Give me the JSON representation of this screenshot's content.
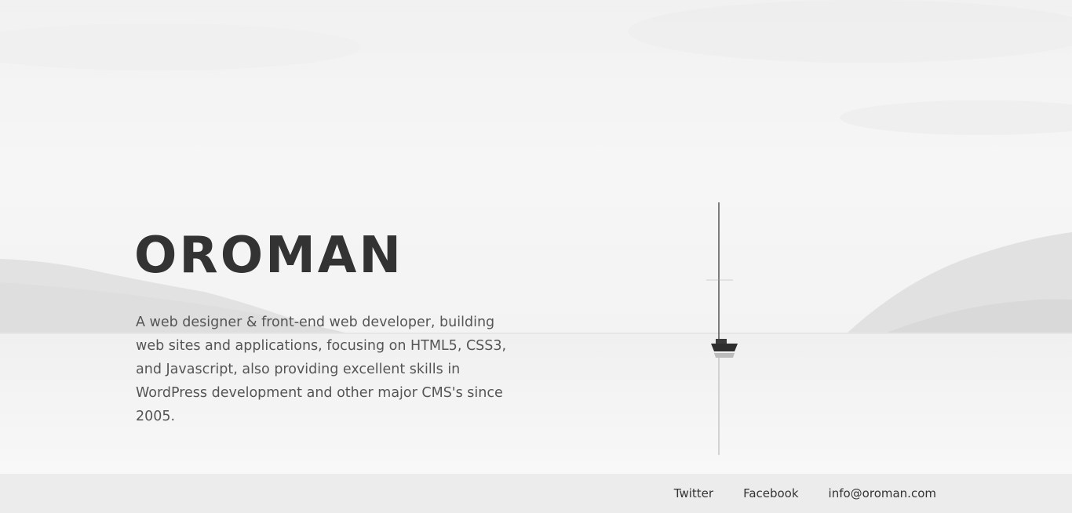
{
  "site": {
    "logo": "OROMAN",
    "tagline": "A web designer & front-end web developer, building web sites and applications, focusing on HTML5, CSS3, and Javascript, also providing excellent skills in WordPress development and other major CMS's since 2005."
  },
  "footer": {
    "links": [
      {
        "label": "Twitter"
      },
      {
        "label": "Facebook"
      },
      {
        "label": "info@oroman.com"
      }
    ]
  },
  "colors": {
    "text_dark": "#333333",
    "text_body": "#555555",
    "footer_bg": "#ececec"
  }
}
